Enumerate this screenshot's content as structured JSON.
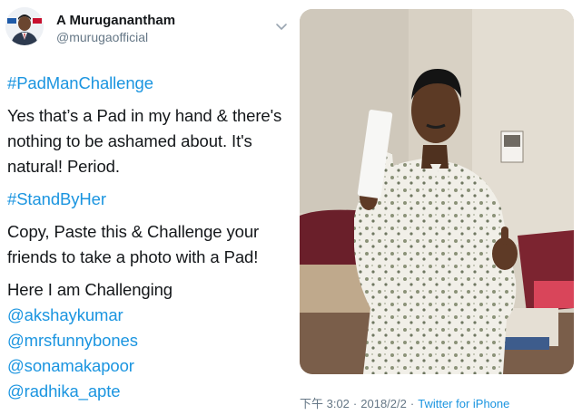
{
  "author": {
    "name": "A Muruganantham",
    "handle": "@murugaofficial"
  },
  "tweet": {
    "hashtag_1": "#PadManChallenge",
    "text_1": "Yes that’s a Pad in my hand & there's",
    "text_2": "nothing to be ashamed about. It's",
    "text_3": "natural! Period.",
    "hashtag_2": "#StandByHer",
    "text_4": "Copy, Paste this & Challenge your",
    "text_5": "friends to take a photo with a Pad!",
    "text_6": "Here I am Challenging",
    "mentions": [
      "@akshaykumar",
      "@mrsfunnybones",
      "@sonamakapoor",
      "@radhika_apte"
    ]
  },
  "meta": {
    "time": "下午 3:02",
    "separator": "·",
    "date": "2018/2/2",
    "source": "Twitter for iPhone"
  },
  "icons": {
    "menu": "chevron-down-icon"
  },
  "colors": {
    "link": "#1b95e0",
    "text": "#14171a",
    "secondary": "#657786"
  }
}
